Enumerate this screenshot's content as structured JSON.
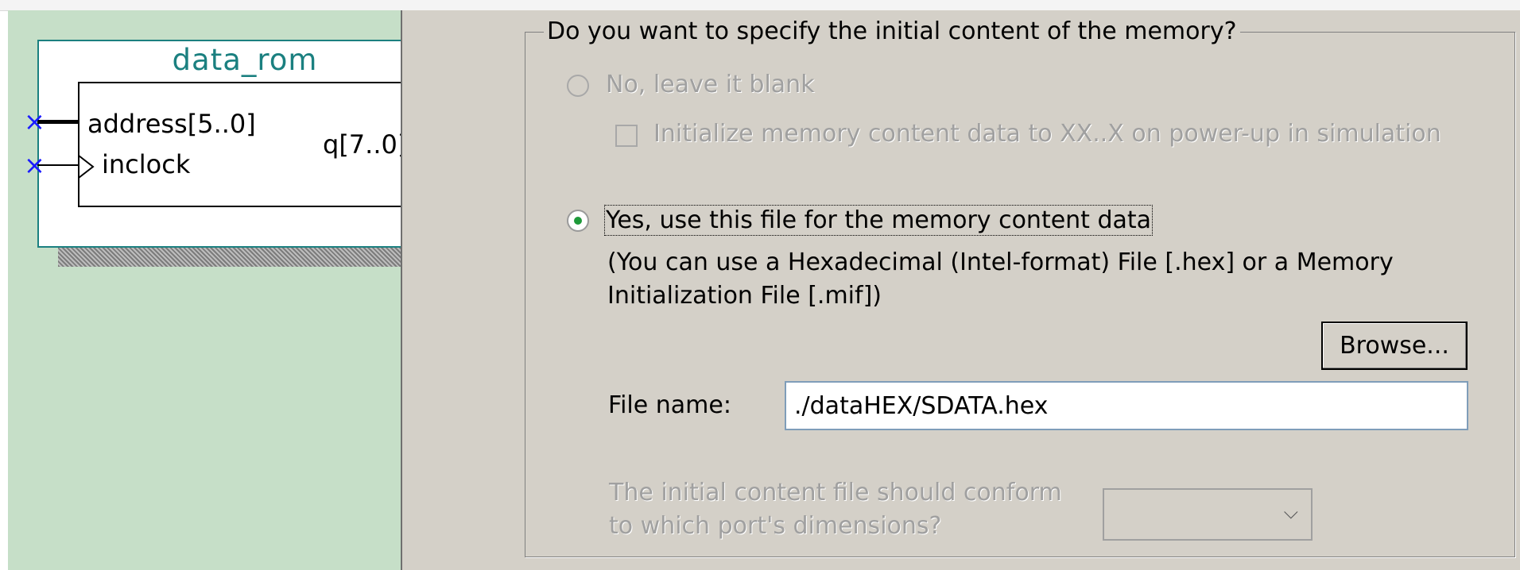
{
  "symbol": {
    "title": "data_rom",
    "ports": {
      "address": "address[5..0]",
      "inclock": "inclock",
      "q": "q[7..0]"
    },
    "pin_marker": "×"
  },
  "dialog": {
    "group_title": "Do you want to specify the initial content of the memory?",
    "option_no": {
      "label": "No, leave it blank",
      "selected": false,
      "enabled": false
    },
    "init_checkbox": {
      "label": "Initialize memory content data to XX..X on power-up in simulation",
      "checked": false,
      "enabled": false
    },
    "option_yes": {
      "label": "Yes, use this file for the memory content data",
      "selected": true
    },
    "hint_line1": "(You can use a Hexadecimal (Intel-format) File [.hex] or a Memory",
    "hint_line2": "Initialization File [.mif])",
    "browse_label": "Browse...",
    "file_name_label": "File name:",
    "file_name_value": "./dataHEX/SDATA.hex",
    "conform_line1": "The initial content file should conform",
    "conform_line2": "to which port's dimensions?",
    "conform_select_value": "",
    "chevron_glyph": "⌵"
  }
}
